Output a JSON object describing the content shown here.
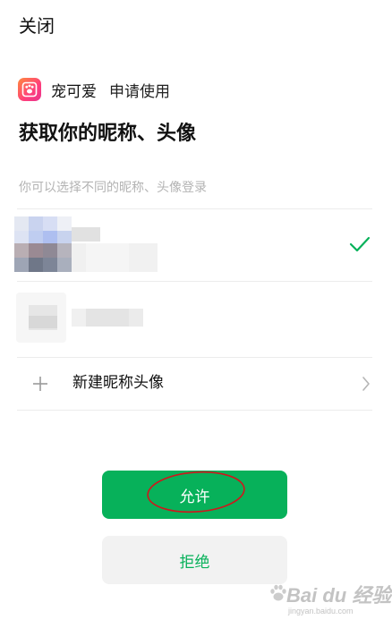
{
  "header": {
    "close_label": "关闭"
  },
  "app": {
    "name": "宠可爱",
    "request_text": "申请使用"
  },
  "page": {
    "title": "获取你的昵称、头像",
    "hint": "你可以选择不同的昵称、头像登录"
  },
  "accounts": {
    "new_label": "新建昵称头像"
  },
  "actions": {
    "allow_label": "允许",
    "reject_label": "拒绝"
  },
  "watermark": {
    "main": "Bai du 经验",
    "sub": "jingyan.baidu.com"
  },
  "colors": {
    "accent": "#07b15a",
    "reject_bg": "#f2f2f2",
    "hint": "#b3b3b3",
    "annotation": "#d0161c"
  },
  "icons": {
    "app_logo": "paw-icon",
    "selected": "check-icon",
    "add": "plus-icon",
    "more": "chevron-right-icon"
  }
}
